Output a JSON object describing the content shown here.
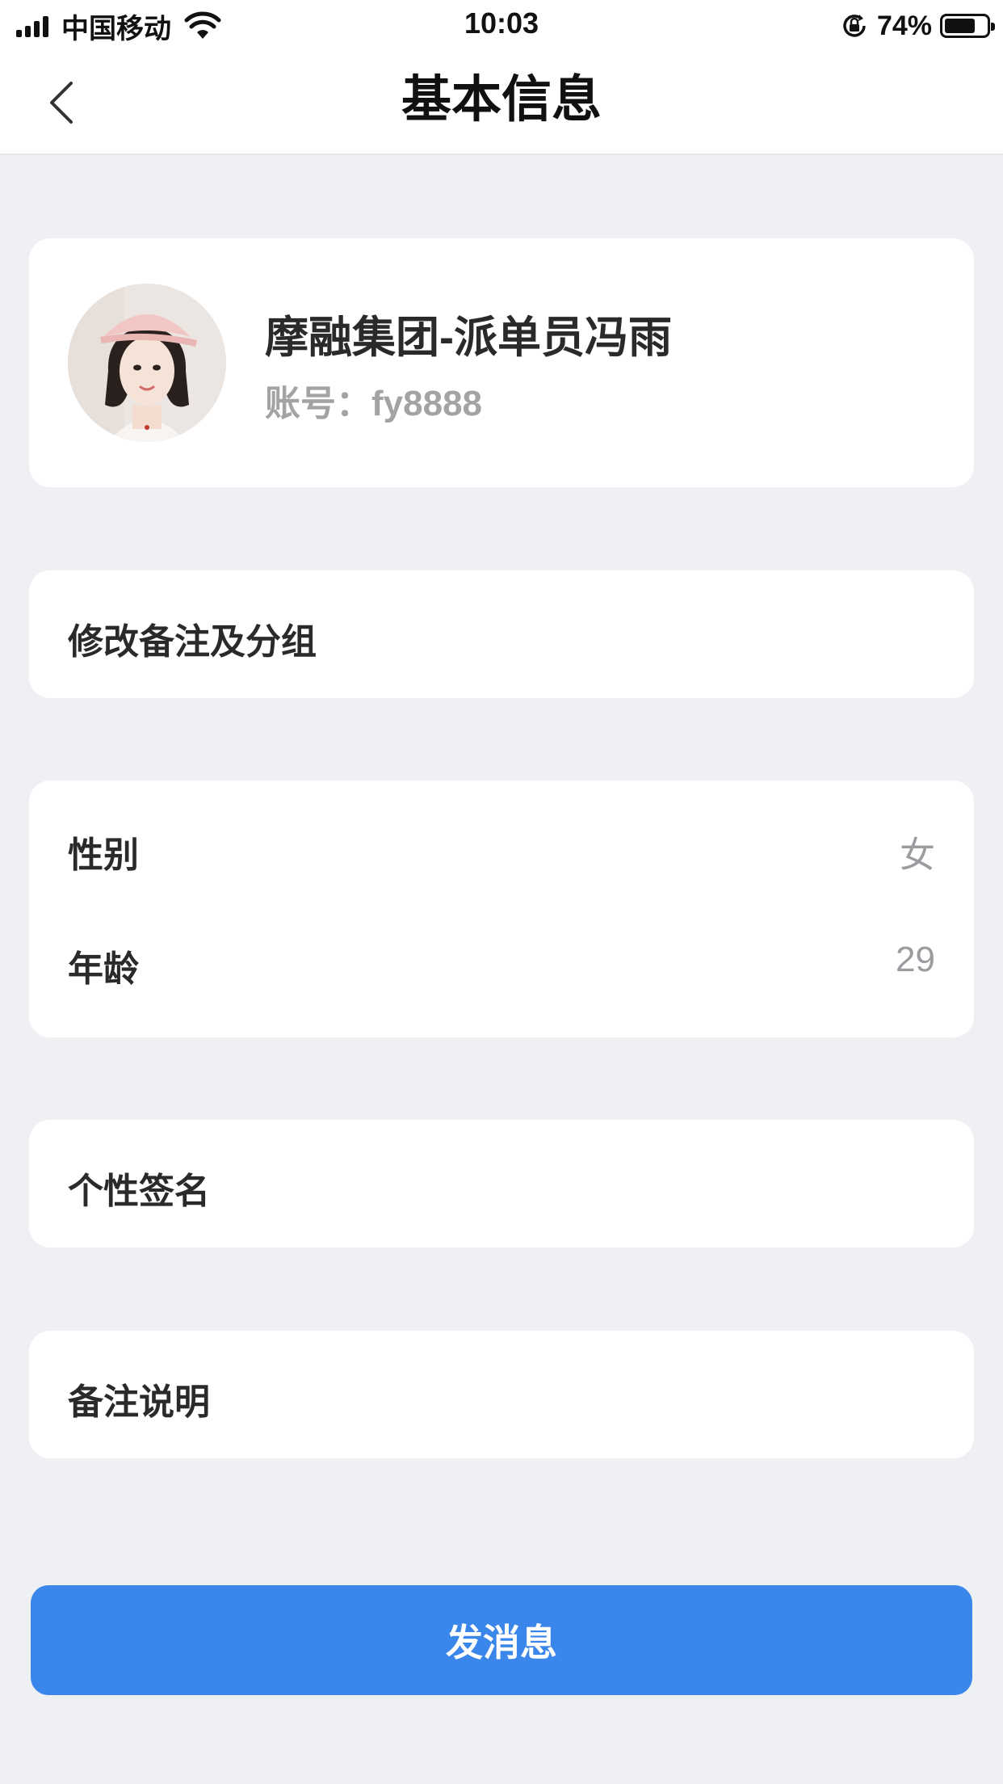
{
  "status_bar": {
    "carrier": "中国移动",
    "time": "10:03",
    "battery_percent": "74%",
    "battery_level": 0.74,
    "icons": [
      "signal-icon",
      "wifi-icon",
      "rotation-lock-icon",
      "battery-icon"
    ]
  },
  "nav": {
    "title": "基本信息",
    "back_icon": "chevron-left-icon"
  },
  "profile": {
    "name": "摩融集团-派单员冯雨",
    "account": "账号：fy8888",
    "avatar": "user-avatar-photo"
  },
  "remark": {
    "label": "修改备注及分组"
  },
  "info": {
    "gender_label": "性别",
    "gender_value": "女",
    "age_label": "年龄",
    "age_value": "29"
  },
  "signature": {
    "label": "个性签名"
  },
  "note": {
    "label": "备注说明"
  },
  "actions": {
    "send_message": "发消息"
  },
  "colors": {
    "background": "#eff0f3",
    "card": "#ffffff",
    "primary": "#3b86ea",
    "secondary_text": "#a3a3a6"
  }
}
